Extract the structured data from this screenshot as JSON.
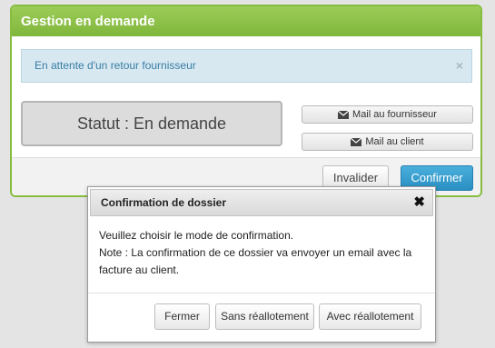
{
  "panel": {
    "title": "Gestion en demande",
    "alert_text": "En attente d'un retour fournisseur",
    "alert_close": "×",
    "status_text": "Statut : En demande",
    "mail_supplier_label": "Mail au fournisseur",
    "mail_client_label": "Mail au client",
    "invalidate_label": "Invalider",
    "confirm_label": "Confirmer"
  },
  "modal": {
    "title": "Confirmation de dossier",
    "close": "✖",
    "line1": "Veuillez choisir le mode de confirmation.",
    "line2": "Note : La confirmation de ce dossier va envoyer un email avec la facture au client.",
    "close_label": "Fermer",
    "without_label": "Sans réallotement",
    "with_label": "Avec réallotement"
  },
  "colors": {
    "header_green": "#86bc3f",
    "primary_blue": "#2a8fc2",
    "alert_bg": "#d7e8f1"
  },
  "icons": [
    "envelope-icon",
    "close-icon"
  ]
}
